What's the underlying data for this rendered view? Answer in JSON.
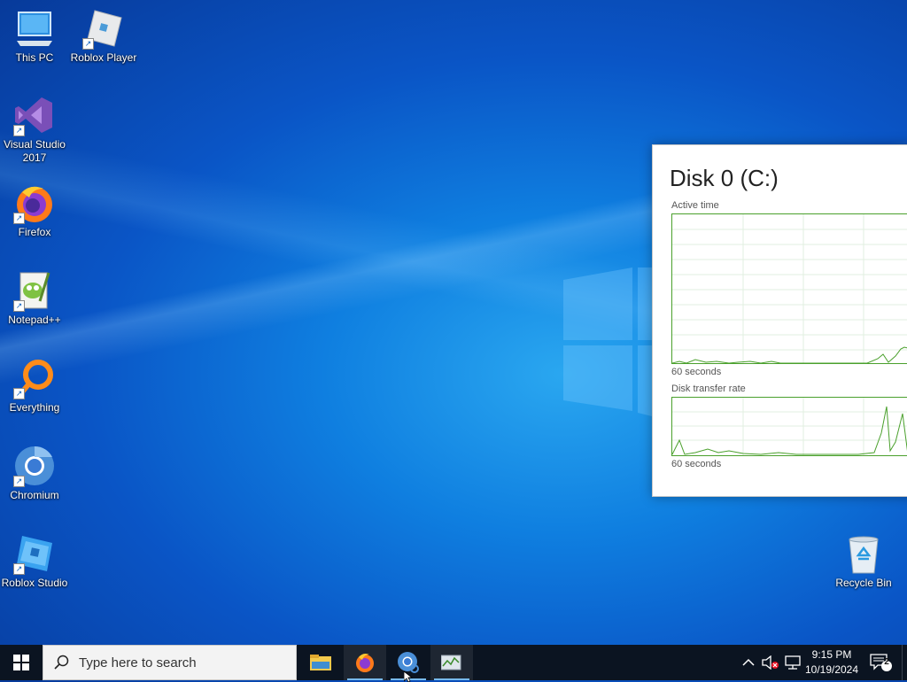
{
  "desktop": {
    "icons": [
      {
        "label": "This PC",
        "icon": "this-pc-icon",
        "shortcut": false
      },
      {
        "label": "Roblox Player",
        "icon": "roblox-player-icon",
        "shortcut": true
      },
      {
        "label": "Visual Studio 2017",
        "icon": "visual-studio-icon",
        "shortcut": true
      },
      {
        "label": "Firefox",
        "icon": "firefox-icon",
        "shortcut": true
      },
      {
        "label": "Notepad++",
        "icon": "notepadpp-icon",
        "shortcut": true
      },
      {
        "label": "Everything",
        "icon": "everything-icon",
        "shortcut": true
      },
      {
        "label": "Chromium",
        "icon": "chromium-icon",
        "shortcut": true
      },
      {
        "label": "Roblox Studio",
        "icon": "roblox-studio-icon",
        "shortcut": true
      },
      {
        "label": "Recycle Bin",
        "icon": "recycle-bin-icon",
        "shortcut": false
      }
    ]
  },
  "task_manager": {
    "title": "Disk 0 (C:)",
    "graph1_label": "Active time",
    "graph1_footer": "60 seconds",
    "graph2_label": "Disk transfer rate",
    "graph2_footer": "60 seconds"
  },
  "taskbar": {
    "search_placeholder": "Type here to search",
    "apps": [
      "file-explorer-icon",
      "firefox-icon",
      "chromium-icon",
      "task-manager-icon"
    ],
    "clock_time": "9:15 PM",
    "clock_date": "10/19/2024",
    "notification_count": "2"
  },
  "colors": {
    "accent": "#76b9ed",
    "graph_line": "#4aa02c"
  }
}
